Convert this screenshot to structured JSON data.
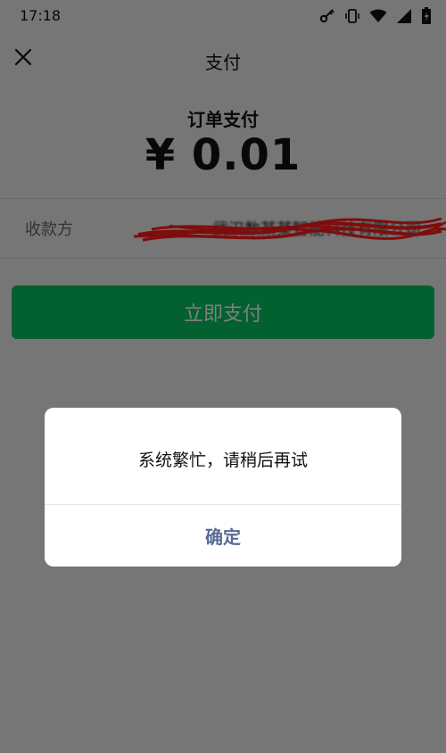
{
  "status_bar": {
    "time": "17:18",
    "icons": [
      "vpn-key-icon",
      "vibrate-icon",
      "wifi-icon",
      "signal-icon",
      "battery-icon"
    ]
  },
  "header": {
    "title": "支付",
    "close_icon": "close-icon"
  },
  "order": {
    "title": "订单支付",
    "amount": "¥ 0.01"
  },
  "payee": {
    "label": "收款方",
    "value": "武汉数某某智能科技有限公司"
  },
  "pay_button": {
    "label": "立即支付"
  },
  "dialog": {
    "message": "系统繁忙，请稍后再试",
    "confirm_label": "确定"
  },
  "colors": {
    "background": "#ededed",
    "pay_green": "#07c160",
    "dialog_link": "#576b95",
    "redaction_red": "#ff1a1a"
  }
}
